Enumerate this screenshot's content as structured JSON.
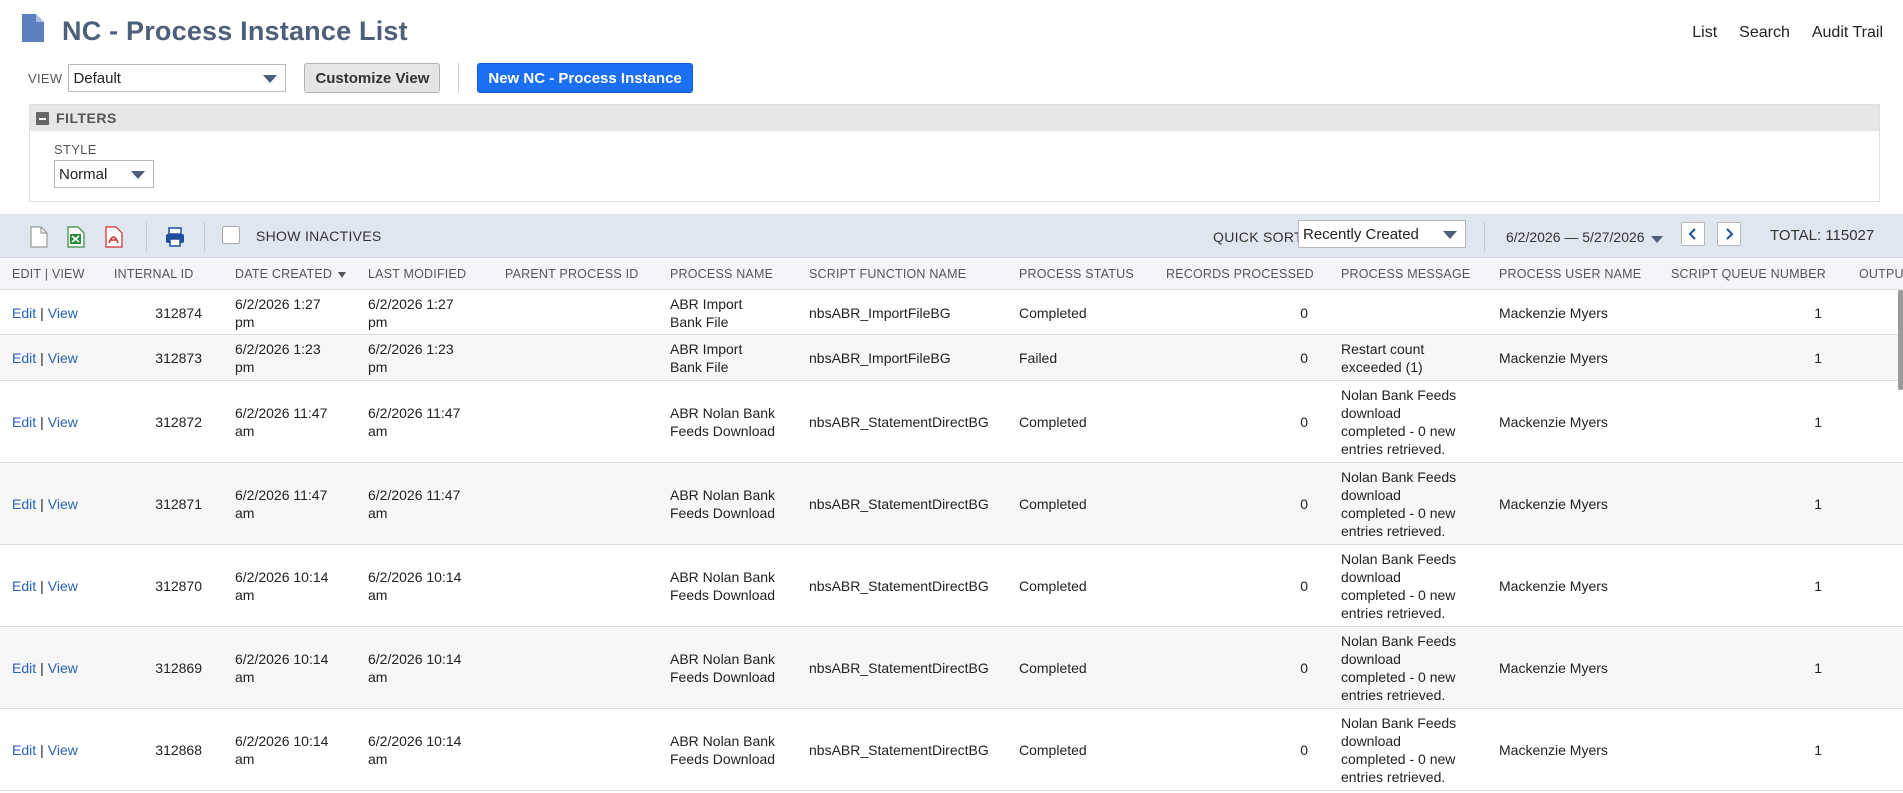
{
  "header": {
    "title": "NC - Process Instance List",
    "links": [
      "List",
      "Search",
      "Audit Trail"
    ]
  },
  "view": {
    "label": "VIEW",
    "selected": "Default",
    "customize_label": "Customize View",
    "new_label": "New NC - Process Instance"
  },
  "filters": {
    "title": "FILTERS",
    "style_label": "STYLE",
    "style_value": "Normal"
  },
  "toolbar": {
    "show_inactives": "SHOW INACTIVES",
    "quick_sort_label": "QUICK SORT",
    "quick_sort_value": "Recently Created",
    "date_range": "6/2/2026 — 5/27/2026",
    "total": "TOTAL: 115027"
  },
  "colors": {
    "title": "#4d5f79",
    "link": "#2862b6",
    "primary_button": "#1b6ff2",
    "toolbar_bg": "#e0e6ef"
  },
  "icons": [
    "document-icon",
    "excel-icon",
    "pdf-icon",
    "print-icon",
    "chevron-left-icon",
    "chevron-right-icon"
  ],
  "table": {
    "columns": [
      "EDIT | VIEW",
      "INTERNAL ID",
      "DATE CREATED",
      "LAST MODIFIED",
      "PARENT PROCESS ID",
      "PROCESS NAME",
      "SCRIPT FUNCTION NAME",
      "PROCESS STATUS",
      "RECORDS PROCESSED",
      "PROCESS MESSAGE",
      "PROCESS USER NAME",
      "SCRIPT QUEUE NUMBER",
      "OUTPU"
    ],
    "edit_label": "Edit",
    "view_label": "View",
    "rows": [
      {
        "id": "312874",
        "created": [
          "6/2/2026 1:27",
          "pm"
        ],
        "modified": [
          "6/2/2026 1:27",
          "pm"
        ],
        "name": [
          "ABR Import",
          "Bank File"
        ],
        "func": "nbsABR_ImportFileBG",
        "status": "Completed",
        "records": "0",
        "message": [],
        "user": "Mackenzie Myers",
        "queue": "1"
      },
      {
        "id": "312873",
        "created": [
          "6/2/2026 1:23",
          "pm"
        ],
        "modified": [
          "6/2/2026 1:23",
          "pm"
        ],
        "name": [
          "ABR Import",
          "Bank File"
        ],
        "func": "nbsABR_ImportFileBG",
        "status": "Failed",
        "records": "0",
        "message": [
          "Restart count",
          "exceeded (1)"
        ],
        "user": "Mackenzie Myers",
        "queue": "1"
      },
      {
        "id": "312872",
        "created": [
          "6/2/2026 11:47",
          "am"
        ],
        "modified": [
          "6/2/2026 11:47",
          "am"
        ],
        "name": [
          "ABR Nolan Bank",
          "Feeds Download"
        ],
        "func": "nbsABR_StatementDirectBG",
        "status": "Completed",
        "records": "0",
        "message": [
          "Nolan Bank Feeds",
          "download",
          "completed - 0 new",
          "entries retrieved."
        ],
        "user": "Mackenzie Myers",
        "queue": "1"
      },
      {
        "id": "312871",
        "created": [
          "6/2/2026 11:47",
          "am"
        ],
        "modified": [
          "6/2/2026 11:47",
          "am"
        ],
        "name": [
          "ABR Nolan Bank",
          "Feeds Download"
        ],
        "func": "nbsABR_StatementDirectBG",
        "status": "Completed",
        "records": "0",
        "message": [
          "Nolan Bank Feeds",
          "download",
          "completed - 0 new",
          "entries retrieved."
        ],
        "user": "Mackenzie Myers",
        "queue": "1"
      },
      {
        "id": "312870",
        "created": [
          "6/2/2026 10:14",
          "am"
        ],
        "modified": [
          "6/2/2026 10:14",
          "am"
        ],
        "name": [
          "ABR Nolan Bank",
          "Feeds Download"
        ],
        "func": "nbsABR_StatementDirectBG",
        "status": "Completed",
        "records": "0",
        "message": [
          "Nolan Bank Feeds",
          "download",
          "completed - 0 new",
          "entries retrieved."
        ],
        "user": "Mackenzie Myers",
        "queue": "1"
      },
      {
        "id": "312869",
        "created": [
          "6/2/2026 10:14",
          "am"
        ],
        "modified": [
          "6/2/2026 10:14",
          "am"
        ],
        "name": [
          "ABR Nolan Bank",
          "Feeds Download"
        ],
        "func": "nbsABR_StatementDirectBG",
        "status": "Completed",
        "records": "0",
        "message": [
          "Nolan Bank Feeds",
          "download",
          "completed - 0 new",
          "entries retrieved."
        ],
        "user": "Mackenzie Myers",
        "queue": "1"
      },
      {
        "id": "312868",
        "created": [
          "6/2/2026 10:14",
          "am"
        ],
        "modified": [
          "6/2/2026 10:14",
          "am"
        ],
        "name": [
          "ABR Nolan Bank",
          "Feeds Download"
        ],
        "func": "nbsABR_StatementDirectBG",
        "status": "Completed",
        "records": "0",
        "message": [
          "Nolan Bank Feeds",
          "download",
          "completed - 0 new",
          "entries retrieved."
        ],
        "user": "Mackenzie Myers",
        "queue": "1"
      }
    ]
  }
}
